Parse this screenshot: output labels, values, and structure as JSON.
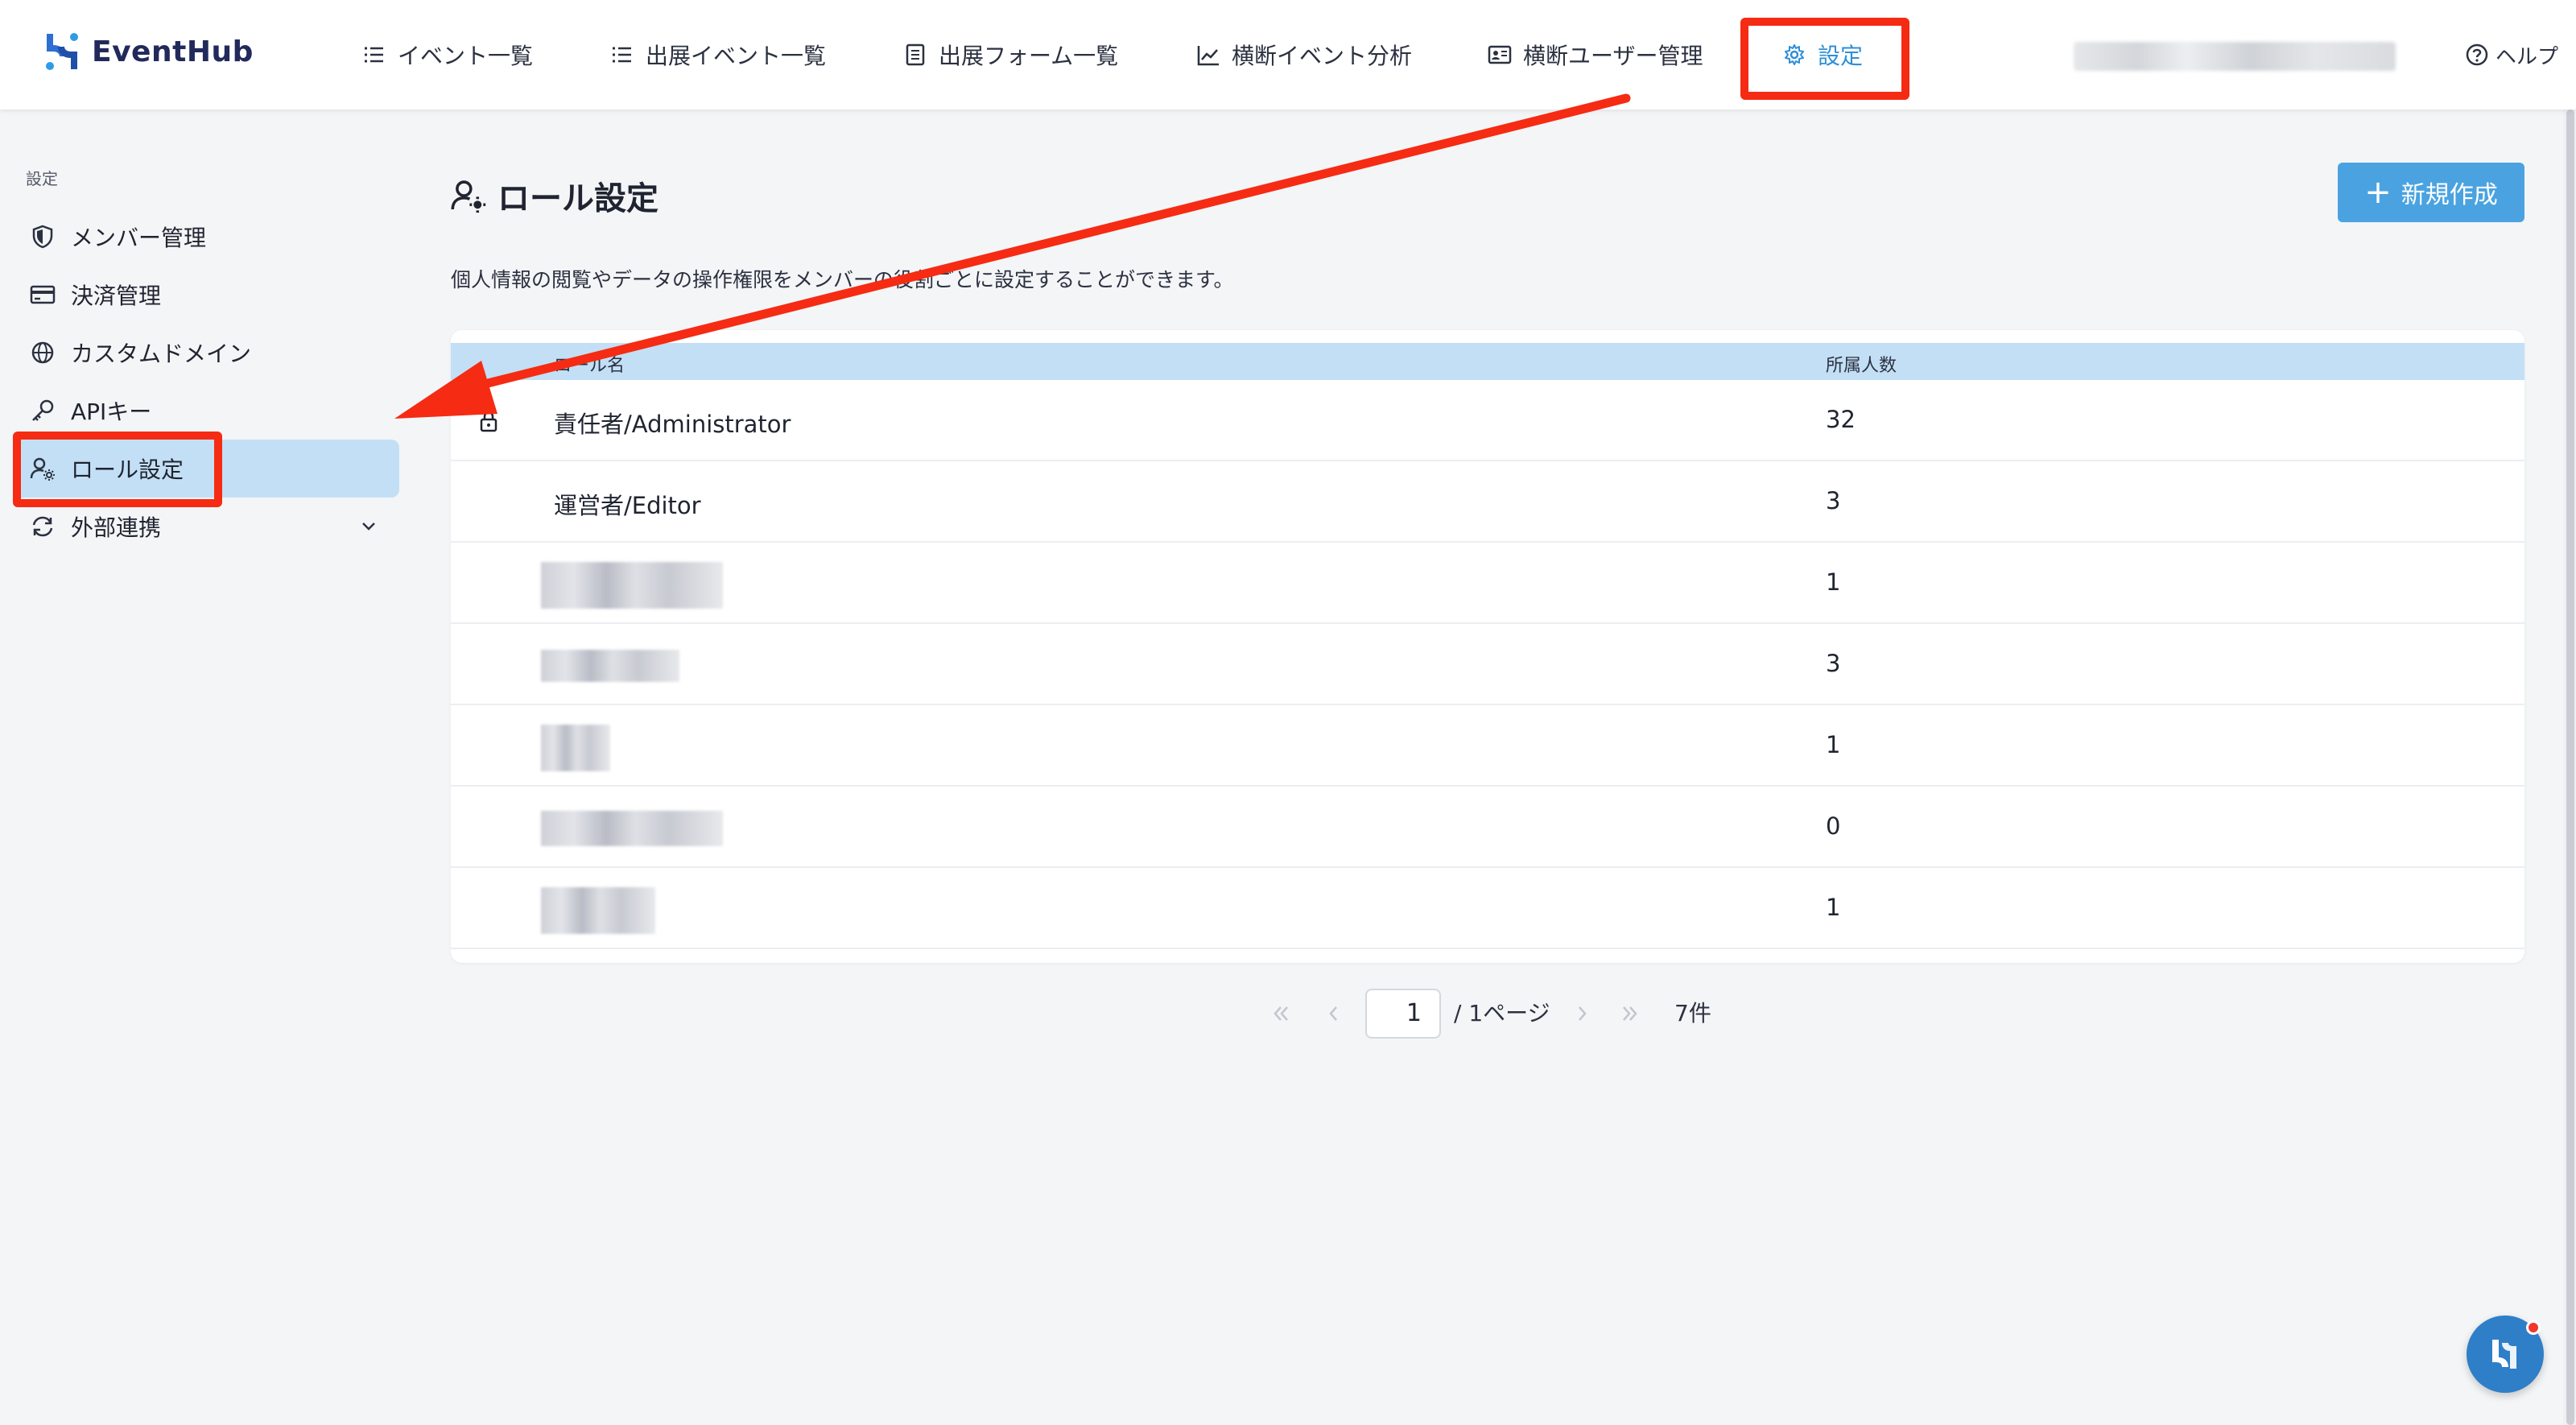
{
  "app": {
    "name": "EventHub"
  },
  "nav": {
    "items": [
      {
        "label": "イベント一覧",
        "icon": "list-icon"
      },
      {
        "label": "出展イベント一覧",
        "icon": "list-icon"
      },
      {
        "label": "出展フォーム一覧",
        "icon": "form-icon"
      },
      {
        "label": "横断イベント分析",
        "icon": "chart-line-icon"
      },
      {
        "label": "横断ユーザー管理",
        "icon": "id-card-icon"
      },
      {
        "label": "設定",
        "icon": "gear-icon",
        "active": true
      }
    ],
    "help_label": "ヘルプ"
  },
  "sidebar": {
    "section_title": "設定",
    "items": [
      {
        "label": "メンバー管理",
        "icon": "shield-icon"
      },
      {
        "label": "決済管理",
        "icon": "credit-card-icon"
      },
      {
        "label": "カスタムドメイン",
        "icon": "globe-icon"
      },
      {
        "label": "APIキー",
        "icon": "key-icon"
      },
      {
        "label": "ロール設定",
        "icon": "user-gear-icon",
        "selected": true
      },
      {
        "label": "外部連携",
        "icon": "sync-icon",
        "expandable": true
      }
    ]
  },
  "main": {
    "title": "ロール設定",
    "description": "個人情報の閲覧やデータの操作権限をメンバーの役割ごとに設定することができます。",
    "new_button_label": "新規作成",
    "table": {
      "columns": [
        "ロール名",
        "所属人数"
      ],
      "rows": [
        {
          "name": "責任者/Administrator",
          "count": "32",
          "locked": true
        },
        {
          "name": "運営者/Editor",
          "count": "3"
        },
        {
          "name": "",
          "count": "1"
        },
        {
          "name": "",
          "count": "3"
        },
        {
          "name": "",
          "count": "1"
        },
        {
          "name": "",
          "count": "0"
        },
        {
          "name": "",
          "count": "1"
        }
      ]
    },
    "pagination": {
      "current_page": "1",
      "page_suffix": "/ 1ページ",
      "total": "7件"
    }
  },
  "colors": {
    "accent": "#4aa3e0",
    "nav_active": "#2e8fd6",
    "highlight": "#f52b13",
    "selected_bg": "#c3dff5"
  }
}
